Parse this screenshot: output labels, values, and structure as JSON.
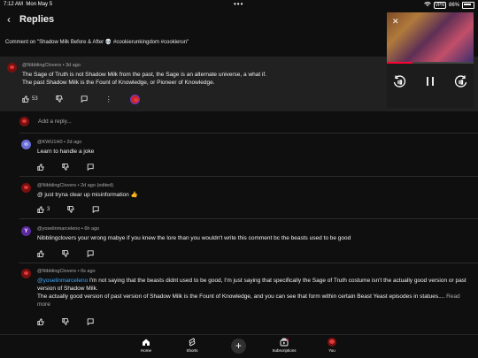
{
  "status_bar": {
    "time": "7:12 AM",
    "date": "Mon May 5",
    "vpn": "VPN",
    "battery": "86%"
  },
  "header": {
    "title": "Replies"
  },
  "comment_on": "Comment on \"Shadow Milk Before & After 💀 #cookierunkingdom #cookierun\"",
  "pinned": {
    "author": "@NibblingClovers",
    "time": "3d ago",
    "text": "The Sage of Truth is not Shadow Milk from the past, the Sage is an alternate universe, a what if.\nThe past Shadow Milk is the Fount of Knowledge, or Pioneer of Knowledge.",
    "likes": "53"
  },
  "add_reply": {
    "placeholder": "Add a reply..."
  },
  "replies": [
    {
      "author": "@KWU1H0",
      "time": "2d ago",
      "text": "Learn to handle a joke",
      "likes": ""
    },
    {
      "author": "@NibblingClovers",
      "time": "2d ago (edited)",
      "text": "@ just tryna clear up misinformation 👍",
      "likes": "3"
    },
    {
      "author": "@yoselinmarceleno",
      "time": "6h ago",
      "text": "Nibblingclovers your wrong mabye if you knew the lore than you wouldn't write this comment bc the beasts used to be good",
      "likes": ""
    },
    {
      "author": "@NibblingClovers",
      "time": "0s ago",
      "mention": "@yoselinmarceleno",
      "text": " I'm not saying that the beasts didnt used to be good, I'm just saying that specifically the Sage of Truth costume isn't the actually good version or past version of Shadow Milk.\nThe actually good version of past version of Shadow Milk is the Fount of Knowledge, and you can see that form within certain Beast Yeast episodes in statues....",
      "read_more": " Read more",
      "likes": ""
    }
  ],
  "avatar_letter": "Y",
  "mini_player": {
    "progress": 0.3
  },
  "bottom_nav": [
    {
      "label": "Home",
      "icon": "home-icon"
    },
    {
      "label": "Shorts",
      "icon": "shorts-icon"
    },
    {
      "label": "Subscriptions",
      "icon": "subscriptions-icon"
    },
    {
      "label": "You",
      "icon": "you-avatar"
    }
  ],
  "colors": {
    "background": "#0f0f0f",
    "pinned_bg": "#212121",
    "link": "#3ea6ff",
    "accent": "#ff0033"
  }
}
